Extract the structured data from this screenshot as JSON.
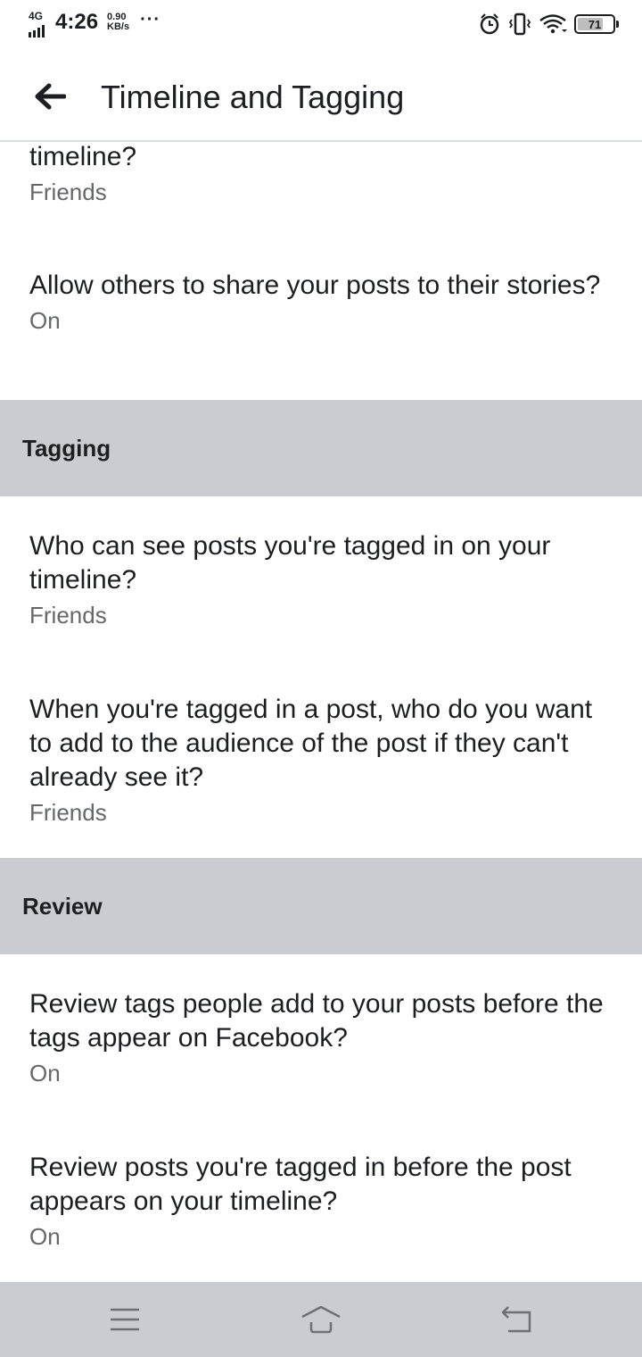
{
  "status_bar": {
    "network": "4G",
    "time": "4:26",
    "speed_value": "0.90",
    "speed_unit": "KB/s",
    "more": "···",
    "battery": "71"
  },
  "app_bar": {
    "title": "Timeline and Tagging",
    "back_icon": "arrow-left-icon"
  },
  "settings_top": [
    {
      "question": "timeline?",
      "value": "Friends"
    },
    {
      "question": "Allow others to share your posts to their stories?",
      "value": "On"
    }
  ],
  "sections": [
    {
      "header": "Tagging",
      "items": [
        {
          "question": "Who can see posts you're tagged in on your timeline?",
          "value": "Friends"
        },
        {
          "question": "When you're tagged in a post, who do you want to add to the audience of the post if they can't already see it?",
          "value": "Friends"
        }
      ]
    },
    {
      "header": "Review",
      "items": [
        {
          "question": "Review tags people add to your posts before the tags appear on Facebook?",
          "value": "On"
        },
        {
          "question": "Review posts you're tagged in before the post appears on your timeline?",
          "value": "On"
        }
      ]
    }
  ],
  "nav_bar": {
    "menu_icon": "menu-icon",
    "home_icon": "home-icon",
    "back_icon": "back-icon"
  },
  "colors": {
    "section_bg": "#c9ccd1",
    "secondary_text": "#65676b",
    "primary_text": "#1c1e21"
  }
}
